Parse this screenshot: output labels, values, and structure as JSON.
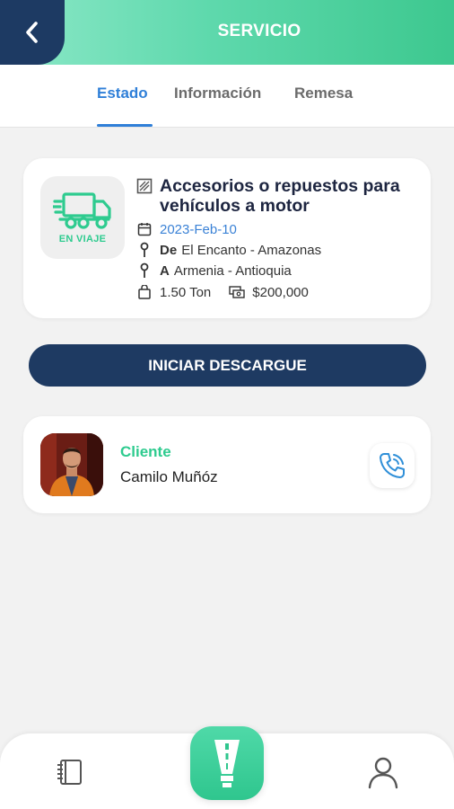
{
  "header": {
    "title": "SERVICIO",
    "back_icon": "chevron-left-icon"
  },
  "tabs": [
    {
      "label": "Estado",
      "active": true
    },
    {
      "label": "Información",
      "active": false
    },
    {
      "label": "Remesa",
      "active": false
    }
  ],
  "service": {
    "status_label": "EN VIAJE",
    "status_icon": "truck-icon",
    "title": "Accesorios o repuestos para vehículos a motor",
    "date": "2023-Feb-10",
    "origin_prefix": "De",
    "origin": "El Encanto - Amazonas",
    "destination_prefix": "A",
    "destination": "Armenia - Antioquia",
    "weight": "1.50 Ton",
    "price": "$200,000"
  },
  "action": {
    "label": "INICIAR DESCARGUE"
  },
  "client": {
    "role": "Cliente",
    "name": "Camilo Muñóz",
    "call_icon": "phone-icon"
  },
  "bottom_nav": {
    "left_icon": "notebook-icon",
    "center_icon": "road-icon",
    "right_icon": "user-icon"
  },
  "colors": {
    "accent_green": "#2ecb8f",
    "navy": "#1e3a62",
    "link_blue": "#2f7fd8"
  }
}
